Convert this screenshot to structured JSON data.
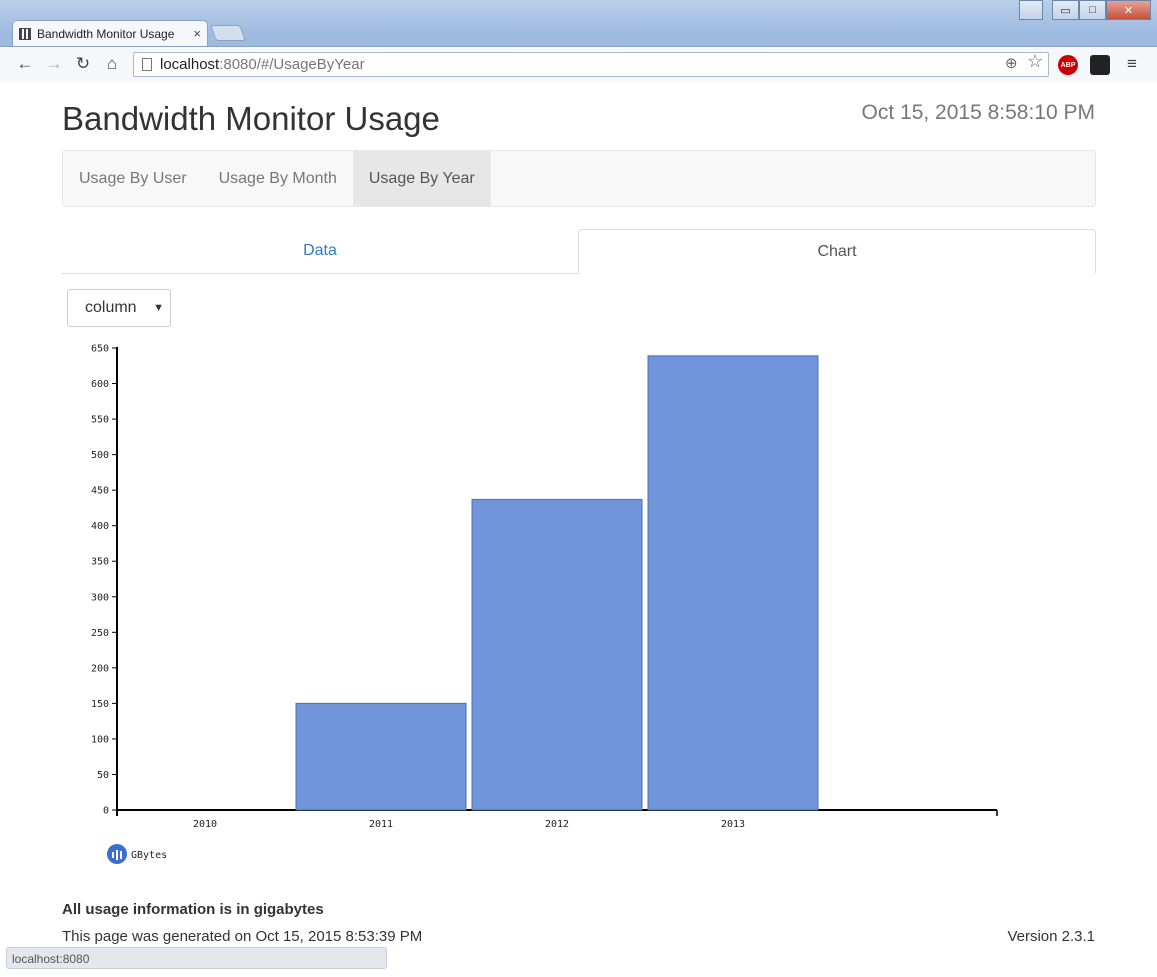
{
  "browser": {
    "tab_title": "Bandwidth Monitor Usage",
    "tab_close": "×",
    "url_host": "localhost",
    "url_path": ":8080/#/UsageByYear",
    "back": "←",
    "forward": "→",
    "reload": "↻",
    "home": "⌂",
    "zoom": "⊕",
    "star": "☆",
    "abp": "ABP",
    "menu": "≡",
    "status_url": "localhost:8080",
    "min": "▭",
    "max": "□",
    "close": "✕",
    "user": "👤"
  },
  "header": {
    "title": "Bandwidth Monitor Usage",
    "clock": "Oct 15, 2015 8:58:10 PM"
  },
  "navbar": {
    "items": [
      {
        "label": "Usage By User"
      },
      {
        "label": "Usage By Month"
      },
      {
        "label": "Usage By Year"
      }
    ],
    "active_index": 2
  },
  "tabs": [
    {
      "label": "Data"
    },
    {
      "label": "Chart"
    }
  ],
  "chart_type_select": {
    "value": "column",
    "caret": "▼"
  },
  "chart_data": {
    "type": "bar",
    "categories": [
      "2010",
      "2011",
      "2012",
      "2013"
    ],
    "series": [
      {
        "name": "GBytes",
        "values": [
          0,
          150,
          437,
          639
        ],
        "color": "#6f94da"
      }
    ],
    "ylim": [
      0,
      650
    ],
    "yticks": [
      0,
      50,
      100,
      150,
      200,
      250,
      300,
      350,
      400,
      450,
      500,
      550,
      600,
      650
    ],
    "legend_placement": "bottom-left",
    "grid": false
  },
  "footer": {
    "note": "All usage information is in gigabytes",
    "generated": "This page was generated on Oct 15, 2015 8:53:39 PM",
    "version": "Version 2.3.1"
  }
}
